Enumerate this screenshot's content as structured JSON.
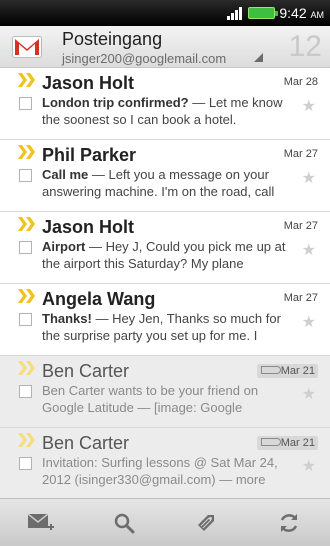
{
  "status": {
    "time": "9:42",
    "ampm": "AM"
  },
  "header": {
    "title": "Posteingang",
    "account": "jsinger200@googlemail.com",
    "count": "12"
  },
  "mails": [
    {
      "sender": "Jason Holt",
      "date": "Mar 28",
      "subject": "London trip confirmed?",
      "body": " — Let me know the soonest so I can book a hotel.",
      "read": false
    },
    {
      "sender": "Phil Parker",
      "date": "Mar 27",
      "subject": "Call me",
      "body": " — Left you a message on your answering machine. I'm on the road, call",
      "read": false
    },
    {
      "sender": "Jason Holt",
      "date": "Mar 27",
      "subject": "Airport",
      "body": " — Hey J, Could you pick me up at the airport this Saturday? My plane",
      "read": false
    },
    {
      "sender": "Angela Wang",
      "date": "Mar 27",
      "subject": "Thanks!",
      "body": " — Hey Jen, Thanks so much for the surprise party you set up for me. I",
      "read": false
    },
    {
      "sender": "Ben Carter",
      "date": "Mar 21",
      "subject": "",
      "body": "Ben Carter wants to be your friend on Google Latitude — [image: Google",
      "read": true
    },
    {
      "sender": "Ben Carter",
      "date": "Mar 21",
      "subject": "",
      "body": "Invitation: Surfing lessons @ Sat Mar 24, 2012 (isinger330@gmail.com) — more",
      "read": true
    }
  ],
  "colors": {
    "accent": "#f0c419",
    "gmail_red": "#d93025",
    "battery": "#3fbf3f"
  }
}
